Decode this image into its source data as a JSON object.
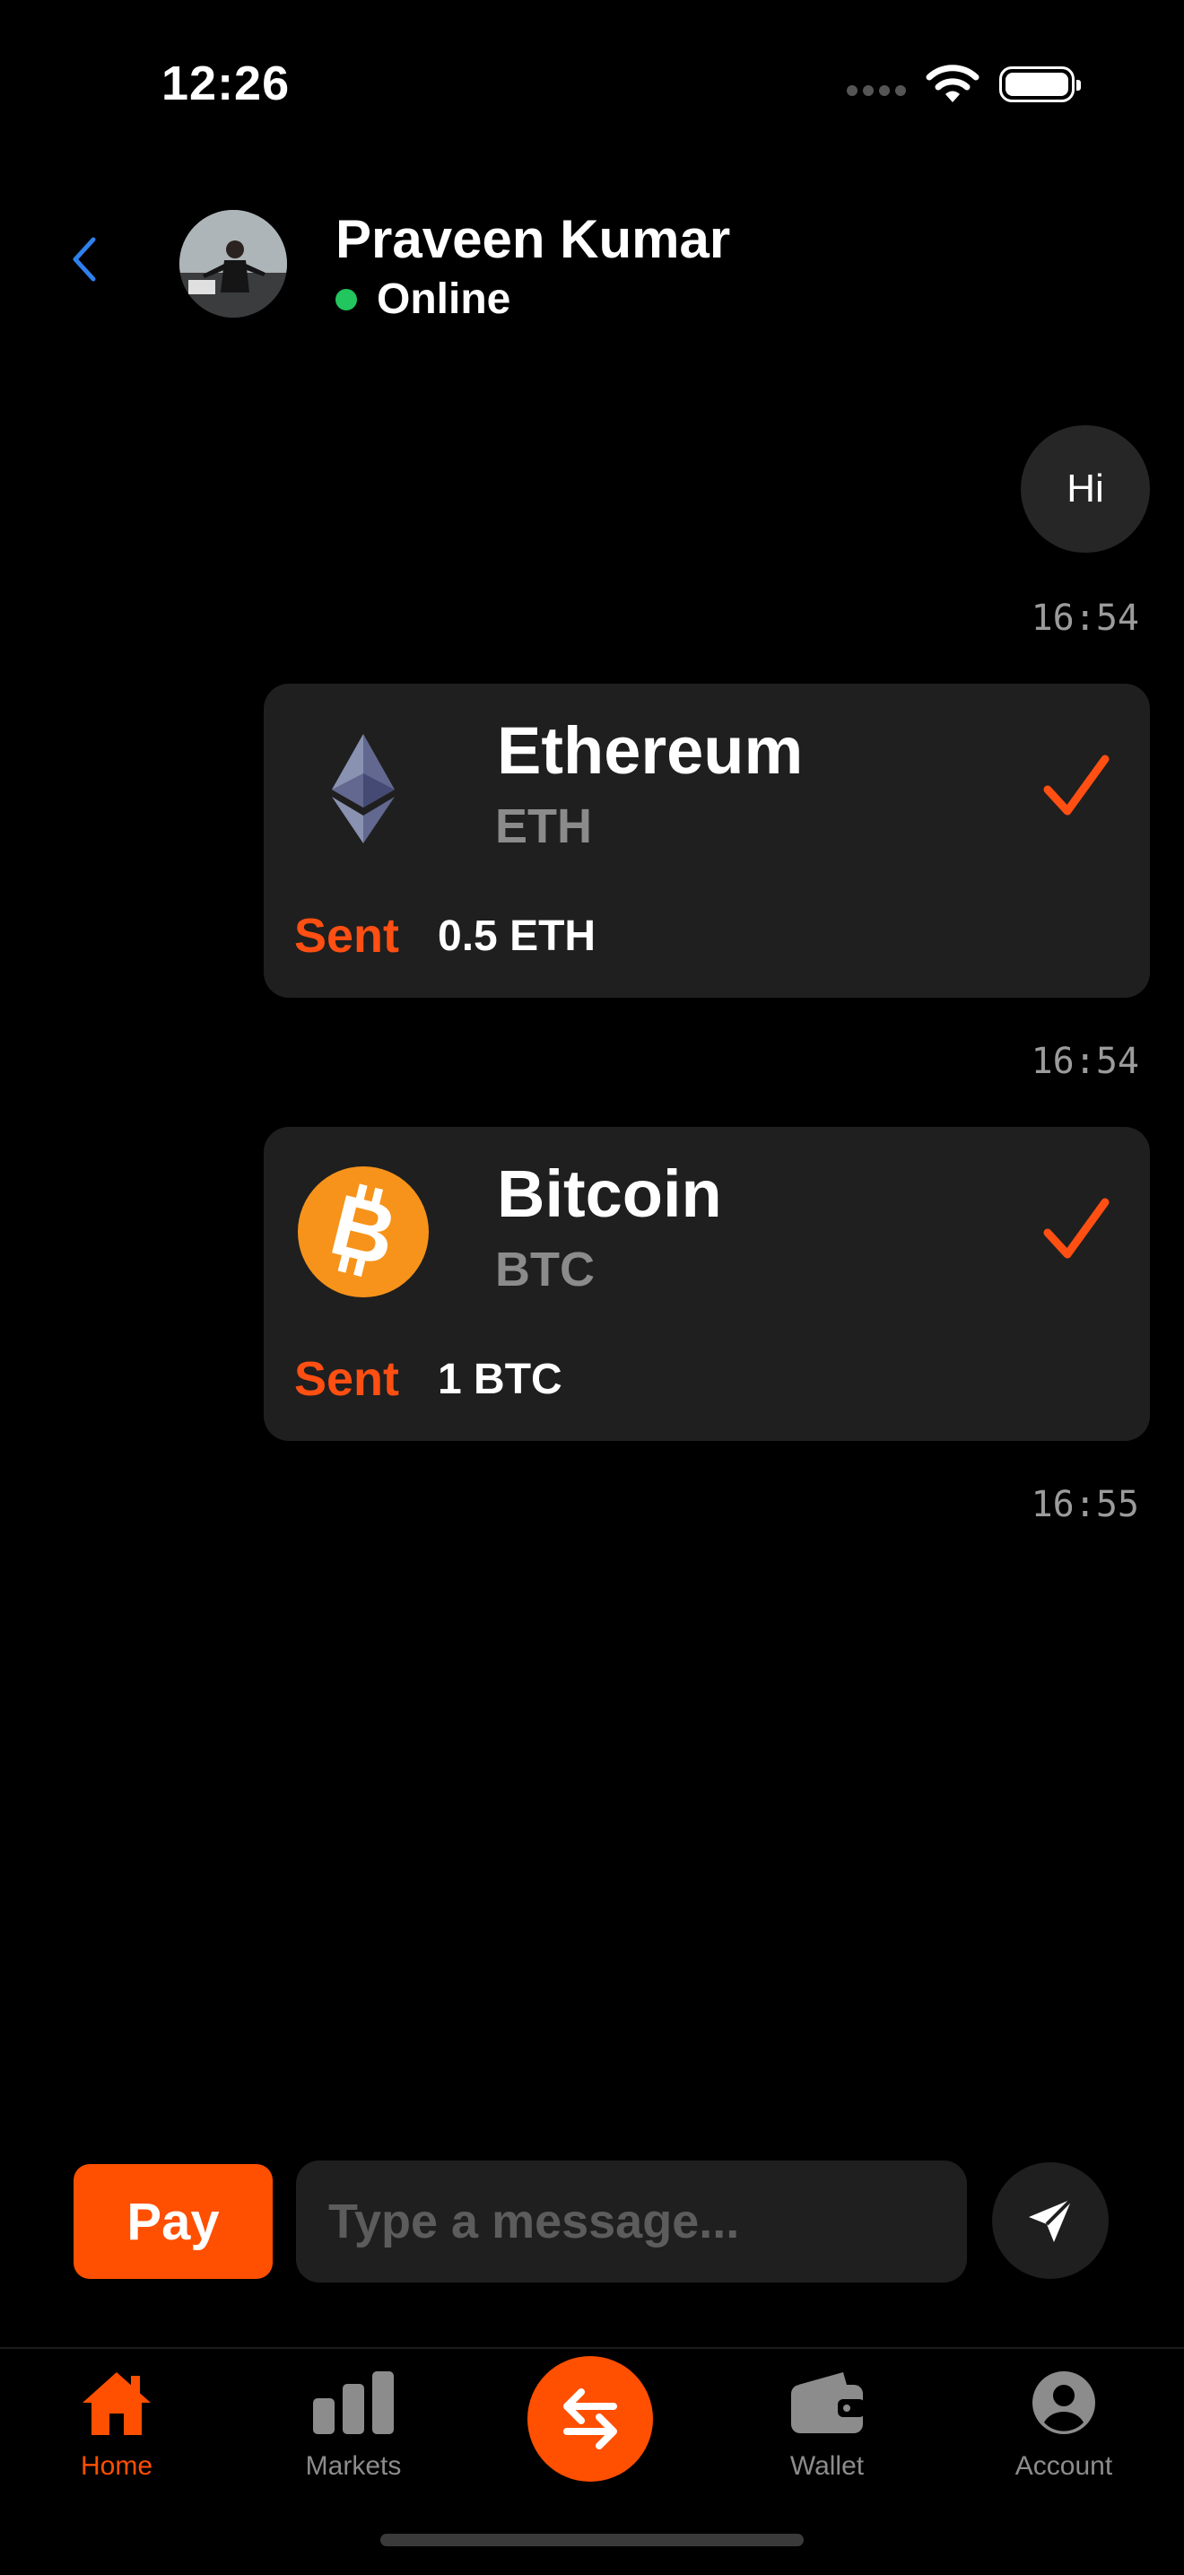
{
  "status_bar": {
    "time": "12:26"
  },
  "header": {
    "contact_name": "Praveen Kumar",
    "status": "Online",
    "back_icon": "chevron-left-icon"
  },
  "messages": [
    {
      "type": "text",
      "text": "Hi",
      "time": "16:54"
    },
    {
      "type": "crypto",
      "coin_name": "Ethereum",
      "symbol": "ETH",
      "sent_label": "Sent",
      "amount": "0.5 ETH",
      "time": "16:54",
      "icon": "ethereum-icon"
    },
    {
      "type": "crypto",
      "coin_name": "Bitcoin",
      "symbol": "BTC",
      "sent_label": "Sent",
      "amount": "1 BTC",
      "time": "16:55",
      "icon": "bitcoin-icon"
    }
  ],
  "composer": {
    "pay_label": "Pay",
    "placeholder": "Type a message...",
    "value": "",
    "send_icon": "send-icon"
  },
  "tabs": [
    {
      "label": "Home",
      "icon": "home-icon",
      "active": true
    },
    {
      "label": "Markets",
      "icon": "bar-chart-icon",
      "active": false
    },
    {
      "label": "",
      "icon": "swap-icon",
      "active": false
    },
    {
      "label": "Wallet",
      "icon": "wallet-icon",
      "active": false
    },
    {
      "label": "Account",
      "icon": "account-icon",
      "active": false
    }
  ],
  "colors": {
    "accent": "#ff4f00",
    "online": "#22c55e",
    "back": "#2f80ed",
    "card_bg": "#1f1f1f",
    "bitcoin": "#f7931a"
  }
}
